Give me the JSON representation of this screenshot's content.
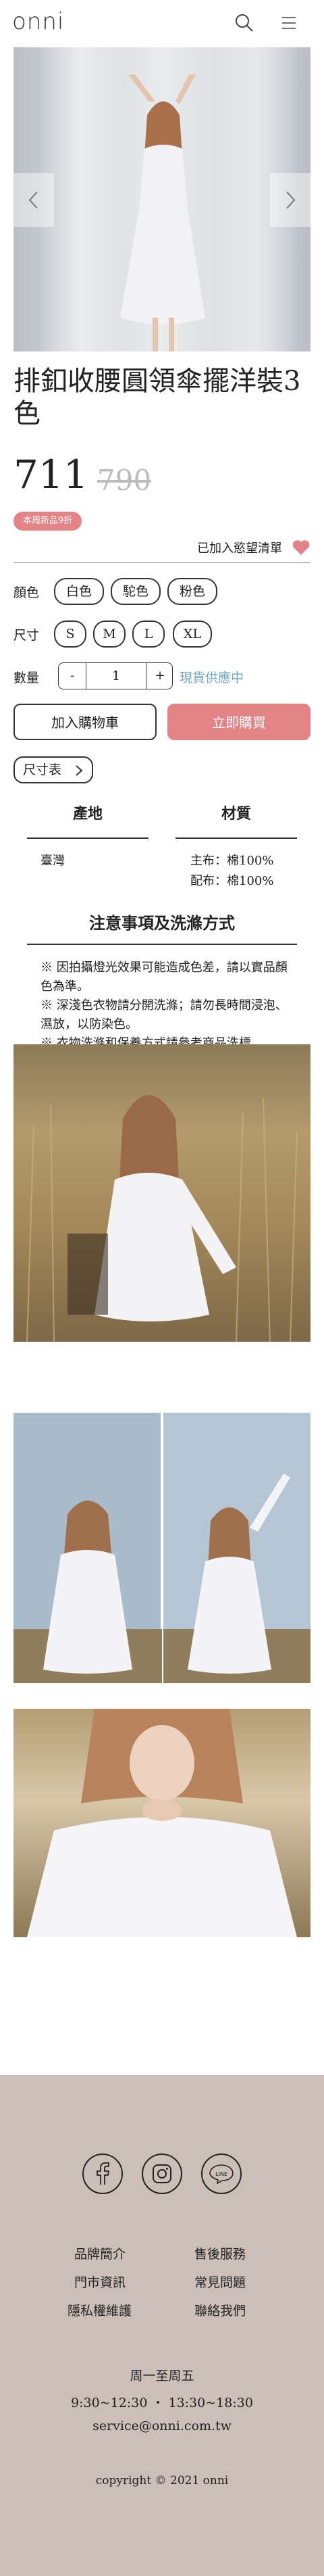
{
  "header": {
    "logo": "onni"
  },
  "product": {
    "title": "排釦收腰圓領傘擺洋裝3色",
    "price": "711",
    "original_price": "790",
    "promo_badge": "本周新品9折",
    "wishlist_label": "已加入慾望清單",
    "color_label": "顏色",
    "colors": [
      "白色",
      "駝色",
      "粉色"
    ],
    "size_label": "尺寸",
    "sizes": [
      "S",
      "M",
      "L",
      "XL"
    ],
    "qty_label": "數量",
    "qty_minus": "-",
    "qty_value": "1",
    "qty_plus": "+",
    "stock_status": "現貨供應中",
    "add_to_cart": "加入購物車",
    "buy_now": "立即購買",
    "size_chart": "尺寸表"
  },
  "specs": {
    "origin_header": "產地",
    "material_header": "材質",
    "origin_value": "臺灣",
    "material_main": "主布：棉100%",
    "material_lining": "配布：棉100%"
  },
  "care": {
    "title": "注意事項及洗滌方式",
    "notes": [
      "※ 因拍攝燈光效果可能造成色差，請以實品顏色為準。",
      "※ 深淺色衣物請分開洗滌；請勿長時間浸泡、濕放，以防染色。",
      "※ 衣物洗滌和保養方式請參考商品洗標"
    ]
  },
  "footer": {
    "social": [
      "facebook-icon",
      "instagram-icon",
      "line-icon"
    ],
    "line_text": "LINE",
    "links": [
      [
        "品牌簡介",
        "售後服務"
      ],
      [
        "門市資訊",
        "常見問題"
      ],
      [
        "隱私權維護",
        "聯絡我們"
      ]
    ],
    "hours_days": "周一至周五",
    "hours_time": "9:30~12:30 ・ 13:30~18:30",
    "email": "service@onni.com.tw",
    "copyright": "copyright © 2021 onni"
  },
  "colors": {
    "accent": "#e48386",
    "stock": "#6fa6bb",
    "footer_bg": "#cbbfb7"
  }
}
